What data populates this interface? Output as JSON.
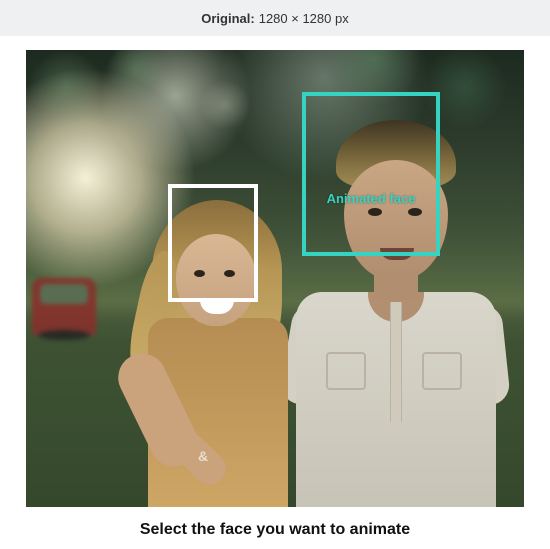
{
  "top_bar": {
    "label": "Original:",
    "dimensions": "1280 × 1280 px"
  },
  "faces": {
    "selected_caption": "Animated face"
  },
  "instruction": "Select the face you want to animate"
}
